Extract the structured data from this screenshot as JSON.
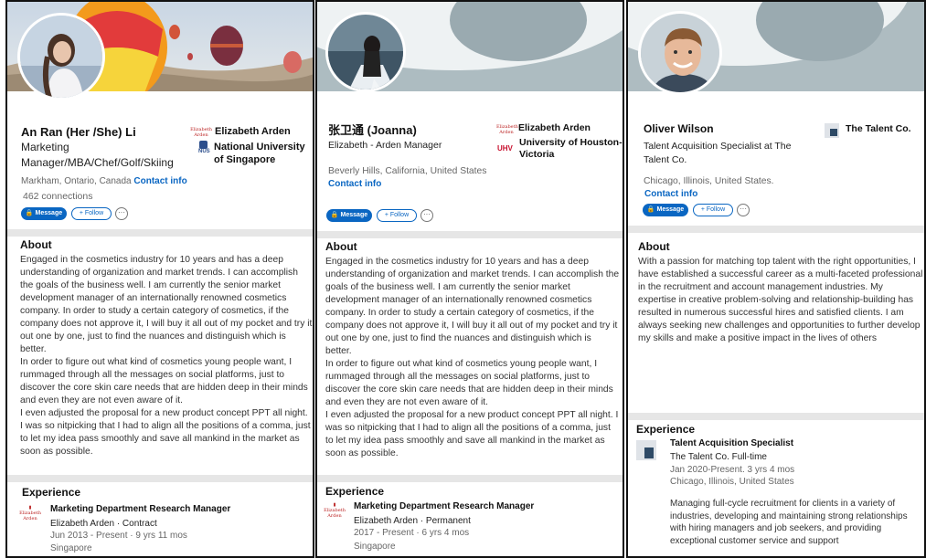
{
  "panels": [
    {
      "name": "An Ran (Her /She) Li",
      "headline": [
        "Marketing",
        "Manager/MBA/Chef/Golf/Skiing"
      ],
      "companies": [
        {
          "logo": "elizabeth-arden-logo",
          "label": "Elizabeth Arden"
        },
        {
          "logo": "nus-logo",
          "label": "National University of Singapore"
        }
      ],
      "location": "Markham, Ontario, Canada",
      "contact": "Contact info",
      "connections": "462 connections",
      "message": "Message",
      "follow": "+ Follow",
      "more": "···",
      "about_title": "About",
      "about": "Engaged in the cosmetics industry for 10 years and has a deep understanding of organization and market trends. I can accomplish the goals of the business well. I am currently the senior market development manager of an internationally renowned cosmetics company. In order to study a certain category of cosmetics, if the company does not approve it, I will buy it all out of my pocket and try it out one by one, just to find the nuances and distinguish which is better.\nIn order to figure out what kind of cosmetics young people want, I rummaged through all the messages on social platforms, just to discover the core skin care needs that are hidden deep in their minds and even they are not even aware of it.\nI even adjusted the proposal for a new product concept PPT all night. I was so nitpicking that I had to align all the positions of a comma, just to let my idea pass smoothly and save all mankind in the market as soon as possible.",
      "exp_title": "Experience",
      "exp": {
        "role": "Marketing Department Research Manager",
        "company": "Elizabeth Arden · Contract",
        "dates": "Jun 2013 - Present · 9 yrs 11 mos",
        "place": "Singapore"
      }
    },
    {
      "name": "张卫通 (Joanna)",
      "headline": [
        "Elizabeth - Arden Manager"
      ],
      "companies": [
        {
          "logo": "elizabeth-arden-logo",
          "label": "Elizabeth Arden"
        },
        {
          "logo": "uhv-logo",
          "label": "University of Houston-Victoria"
        }
      ],
      "location": "Beverly Hills, California, United States",
      "contact": "Contact info",
      "message": "Message",
      "follow": "+ Follow",
      "more": "···",
      "about_title": "About",
      "about": "Engaged in the cosmetics industry for 10 years and has a deep understanding of organization and market trends. I can accomplish the goals of the business well. I am currently the senior market development manager of an internationally renowned cosmetics company. In order to study a certain category of cosmetics, if the company does not approve it, I will buy it all out of my pocket and try it out one by one, just to find the nuances and distinguish which is better.\nIn order to figure out what kind of cosmetics young people want, I rummaged through all the messages on social platforms, just to discover the core skin care needs that are hidden deep in their minds and even they are not even aware of it.\nI even adjusted the proposal for a new product concept PPT all night. I was so nitpicking that I had to align all the positions of a comma, just to let my idea pass smoothly and save all mankind in the market as soon as possible.",
      "exp_title": "Experience",
      "exp": {
        "role": "Marketing Department Research Manager",
        "company": "Elizabeth Arden · Permanent",
        "dates": "2017 - Present · 6 yrs 4 mos",
        "place": "Singapore"
      }
    },
    {
      "name": "Oliver Wilson",
      "headline": [
        "Talent Acquisition Specialist at The",
        "Talent Co."
      ],
      "companies": [
        {
          "logo": "talent-co-logo",
          "label": "The Talent Co."
        }
      ],
      "location": "Chicago, Illinois, United States.",
      "contact": "Contact info",
      "message": "Message",
      "follow": "+ Follow",
      "more": "···",
      "about_title": "About",
      "about": "With a passion for matching top talent with the right opportunities, I have established a successful career as a multi-faceted professional in the recruitment and account management industries. My expertise in creative problem-solving and relationship-building has resulted in numerous successful hires and satisfied clients. I am always seeking new challenges and opportunities to further develop my skills and make a positive impact in the lives of others",
      "exp_title": "Experience",
      "exp": {
        "role": "Talent Acquisition Specialist",
        "company": "The Talent Co. Full-time",
        "dates": "Jan 2020-Present. 3 yrs 4 mos",
        "place": "Chicago, Illinois, United States",
        "desc": "Managing full-cycle recruitment for clients in a variety of industries, developing and maintaining strong relationships with hiring managers and job seekers, and providing exceptional customer service and support"
      }
    }
  ],
  "colors": {
    "accent": "#0a66c2",
    "banner": "#a9b8bd",
    "separator": "#e6e6e6"
  },
  "logo_text": {
    "elizabeth_arden": "Elizabeth Arden",
    "nus": "NUS",
    "uhv": "UHV"
  }
}
